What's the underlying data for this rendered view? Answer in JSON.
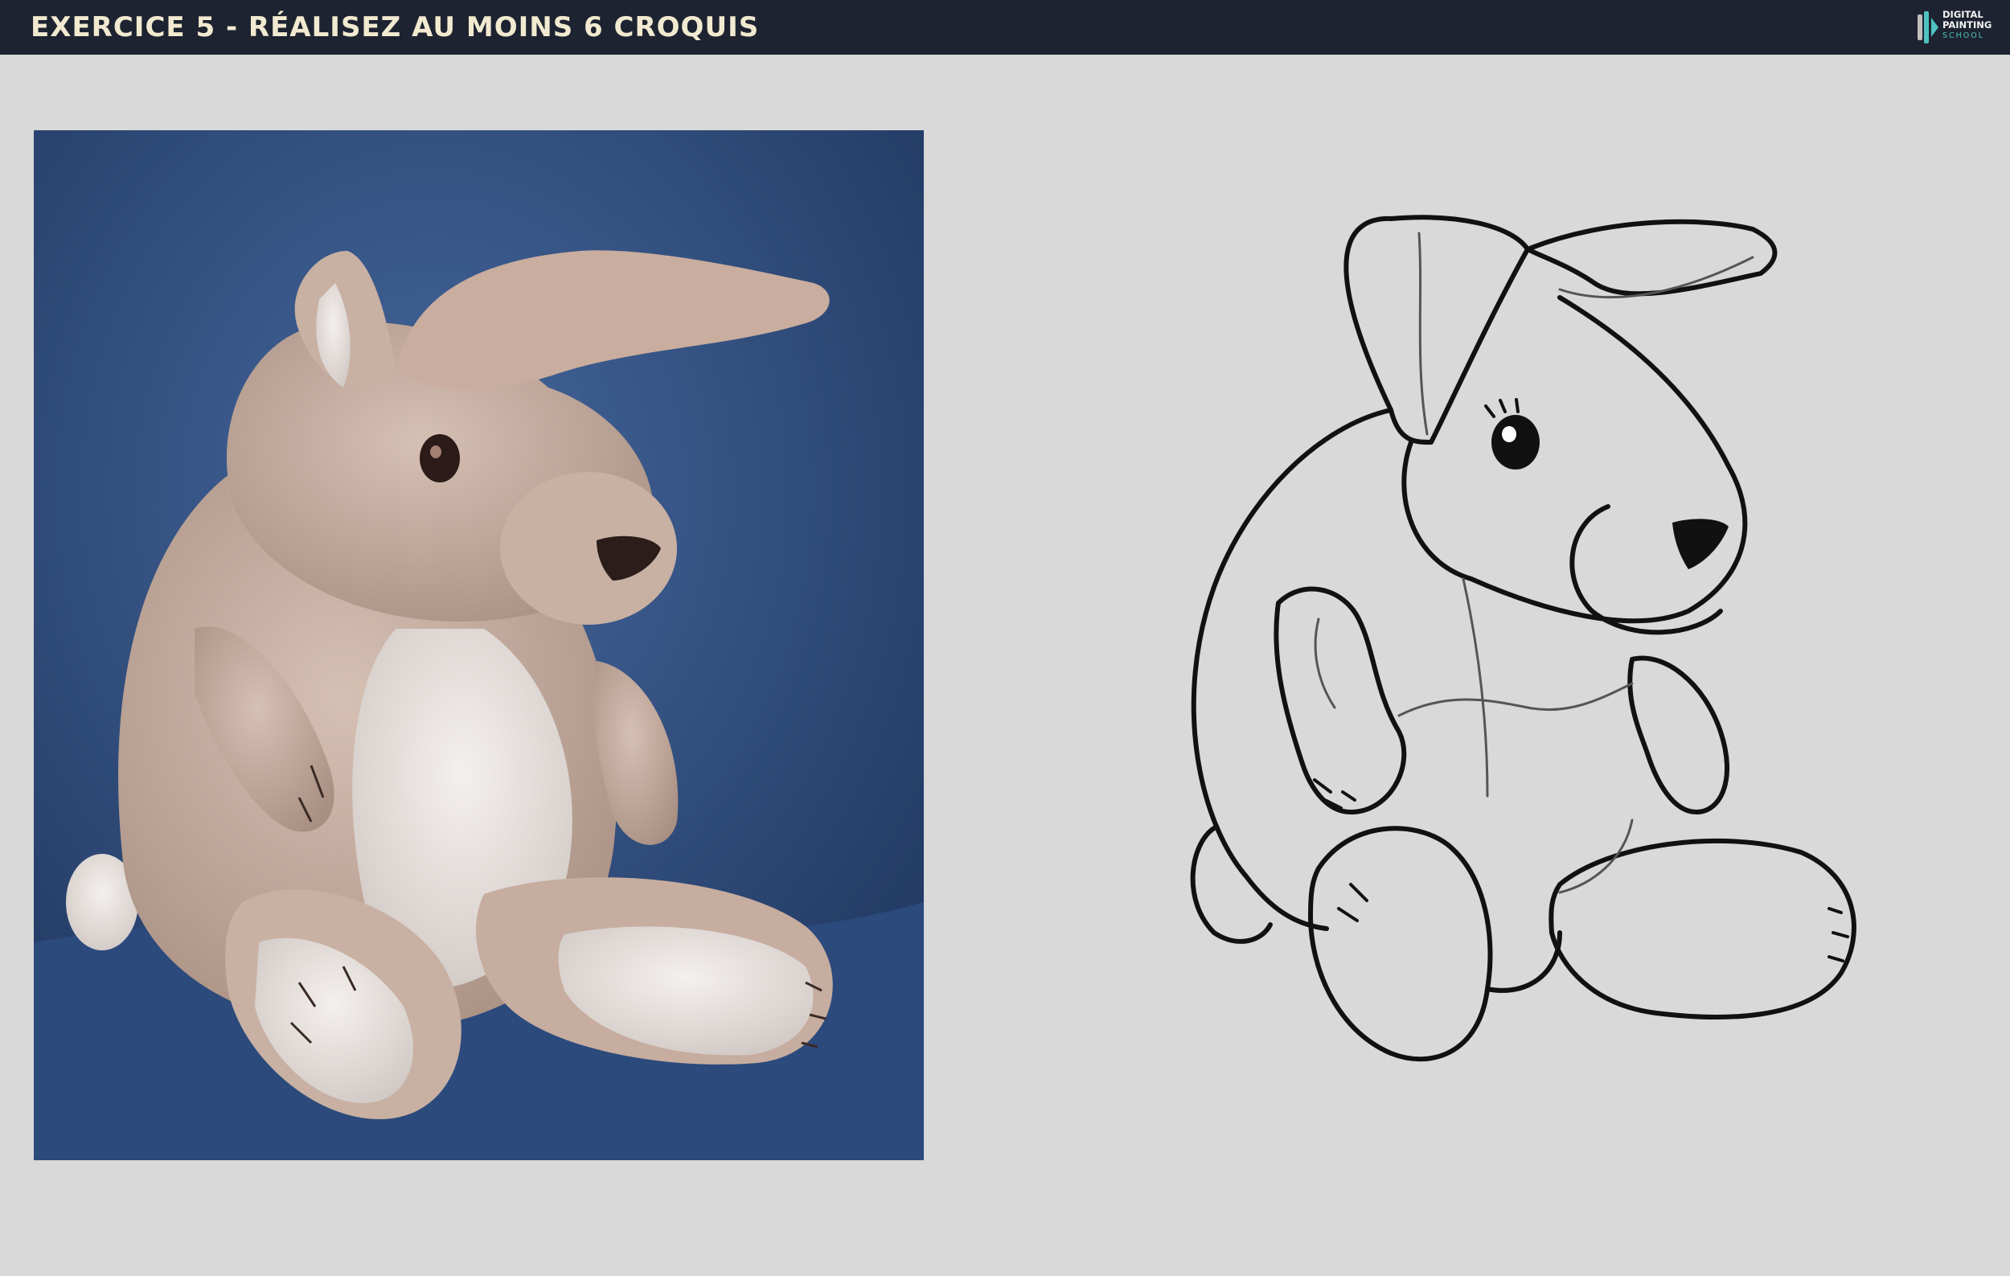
{
  "header": {
    "title": "EXERCICE 5 - RÉALISEZ AU MOINS 6 CROQUIS",
    "logo": {
      "line1": "DIGITAL",
      "line2": "PAINTING",
      "line3": "SCHOOL"
    }
  },
  "colors": {
    "topbar": "#1d2330",
    "title": "#f2ead0",
    "canvas": "#d9d9d9",
    "photo_background": "#2f4c7c",
    "plush": "#c9b0a2",
    "plush_light": "#efe9e6",
    "accent_teal": "#4fc3c1"
  },
  "icons": {
    "logo": "digital-painting-school-logo"
  }
}
